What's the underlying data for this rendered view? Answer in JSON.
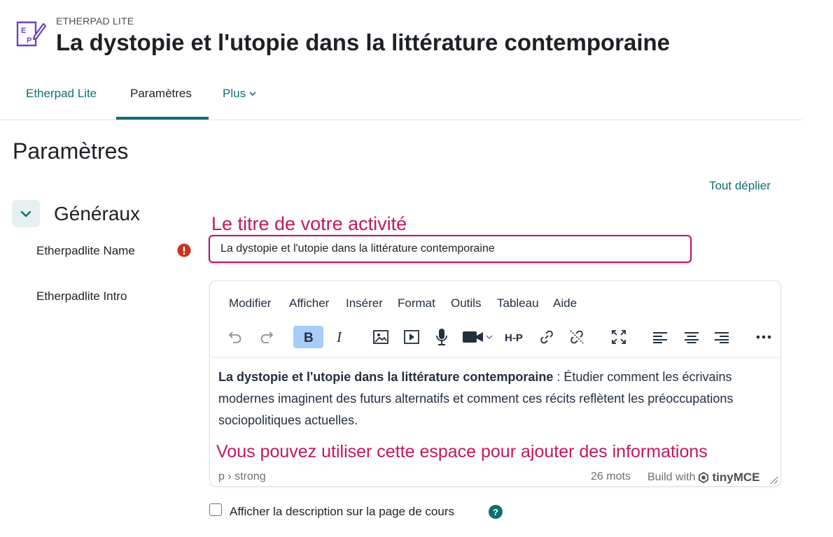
{
  "header": {
    "module_label": "ETHERPAD LITE",
    "title": "La dystopie et l'utopie dans la littérature contemporaine",
    "icon": "etherpad-logo-icon"
  },
  "tabs": [
    {
      "label": "Etherpad Lite",
      "active": false
    },
    {
      "label": "Paramètres",
      "active": true
    },
    {
      "label": "Plus",
      "dropdown": true
    }
  ],
  "section": {
    "title": "Paramètres",
    "expand_all": "Tout déplier",
    "group": "Généraux"
  },
  "form": {
    "name_label": "Etherpadlite Name",
    "name_value": "La dystopie et l'utopie dans la littérature contemporaine",
    "intro_label": "Etherpadlite Intro",
    "editor_menu": [
      "Modifier",
      "Afficher",
      "Insérer",
      "Format",
      "Outils",
      "Tableau",
      "Aide"
    ],
    "toolbar": [
      "undo-icon",
      "redo-icon",
      "bold-icon",
      "italic-icon",
      "image-icon",
      "media-icon",
      "microphone-icon",
      "video-icon",
      "h5p-icon",
      "link-icon",
      "unlink-icon",
      "fullscreen-icon",
      "align-left-icon",
      "align-center-icon",
      "align-right-icon",
      "more-icon"
    ],
    "content_bold": "La dystopie et l'utopie dans la littérature contemporaine",
    "content_rest": " : Étudier comment les écrivains modernes imaginent des futurs alternatifs et comment ces récits reflètent les préoccupations sociopolitiques actuelles.",
    "status_path": "p › strong",
    "word_count": "26 mots",
    "build_with": "Build with",
    "tinymce": "tinyMCE",
    "h5p_text": "H-P",
    "show_desc_label": "Afficher la description sur la page de cours"
  },
  "annotations": {
    "title_hint": "Le titre de votre activité",
    "space_hint": "Vous pouvez utiliser cette espace pour ajouter des informations"
  },
  "colors": {
    "accent": "#0f6e73",
    "annotation": "#c2185b",
    "required": "#ca3120",
    "logo": "#6f42c1",
    "bold_active": "#a6ccf7"
  }
}
